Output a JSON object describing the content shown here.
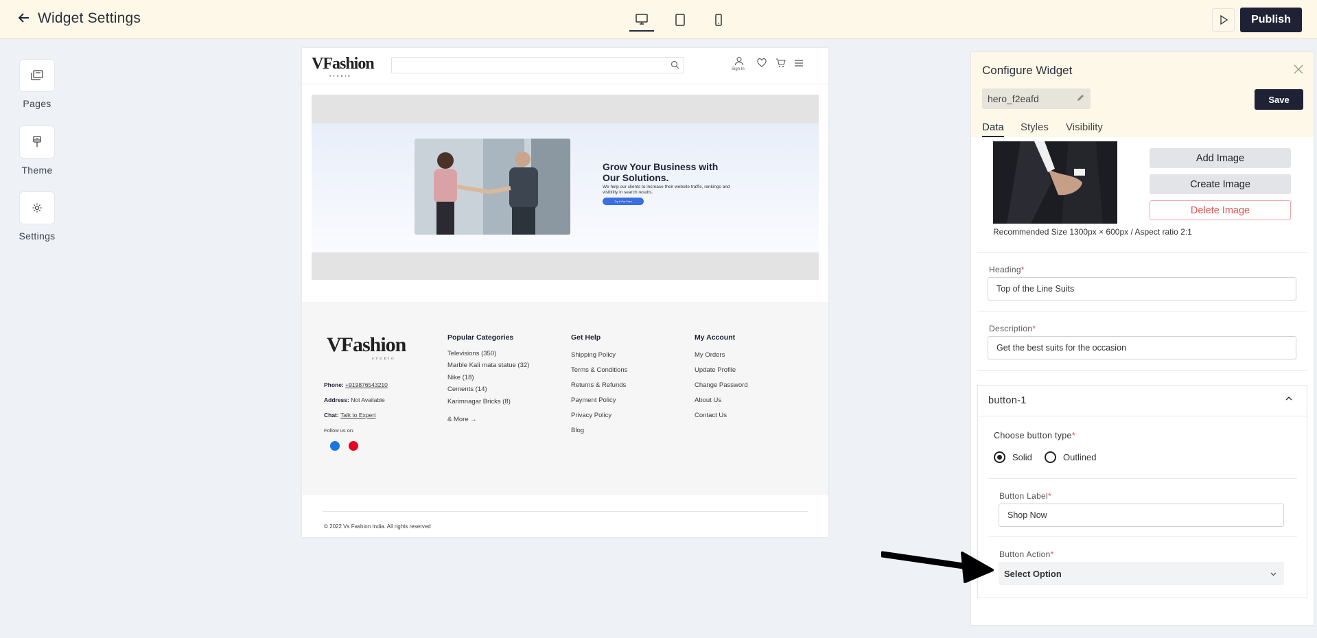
{
  "topbar": {
    "title": "Widget Settings",
    "publish_label": "Publish"
  },
  "rail": {
    "items": [
      {
        "label": "Pages"
      },
      {
        "label": "Theme"
      },
      {
        "label": "Settings"
      }
    ]
  },
  "preview": {
    "header": {
      "logo": "VFashion",
      "logo_sub": "STUDIO",
      "signin": "Sign In"
    },
    "hero": {
      "heading": "Grow Your Business with Our Solutions.",
      "description": "We help our clients to increase their website traffic, rankings and visibility in search results.",
      "button": "Try It For Free"
    },
    "footer": {
      "logo": "VFashion",
      "logo_sub": "STUDIO",
      "phone_label": "Phone:",
      "phone_value": "+919876543210",
      "address_label": "Address:",
      "address_value": "Not Available",
      "chat_label": "Chat:",
      "chat_value": "Talk to Expert",
      "follow": "Follow us on:",
      "columns": [
        {
          "title": "Popular Categories",
          "links": [
            "Televisions (350)",
            "Marble Kali mata statue (32)",
            "Nike (18)",
            "Cements (14)",
            "Karimnagar Bricks (8)"
          ],
          "more": "& More →"
        },
        {
          "title": "Get Help",
          "links": [
            "Shipping Policy",
            "Terms & Conditions",
            "Returns & Refunds",
            "Payment Policy",
            "Privacy Policy",
            "Blog"
          ]
        },
        {
          "title": "My Account",
          "links": [
            "My Orders",
            "Update Profile",
            "Change Password",
            "About Us",
            "Contact Us"
          ]
        }
      ],
      "copyright": "© 2022 Vs Fashion India. All rights reserved"
    }
  },
  "panel": {
    "title": "Configure Widget",
    "widget_id": "hero_f2eafd",
    "save_label": "Save",
    "tabs": [
      {
        "label": "Data",
        "active": true
      },
      {
        "label": "Styles",
        "active": false
      },
      {
        "label": "Visibility",
        "active": false
      }
    ],
    "image_buttons": {
      "add": "Add Image",
      "create": "Create Image",
      "delete": "Delete Image"
    },
    "recommended": "Recommended Size 1300px × 600px / Aspect ratio 2:1",
    "heading_label": "Heading",
    "heading_value": "Top of the Line Suits",
    "description_label": "Description",
    "description_value": "Get the best suits for the occasion",
    "button_section": {
      "title": "button-1",
      "type_label": "Choose button type",
      "options": [
        {
          "label": "Solid",
          "checked": true
        },
        {
          "label": "Outlined",
          "checked": false
        }
      ],
      "label_label": "Button Label",
      "label_value": "Shop Now",
      "action_label": "Button Action",
      "action_value": "Select Option"
    },
    "required_mark": "*"
  },
  "colors": {
    "topbar_bg": "#fdf8e8",
    "primary_dark": "#1f2235",
    "danger": "#e05454",
    "hero_button": "#3b6ee0"
  }
}
